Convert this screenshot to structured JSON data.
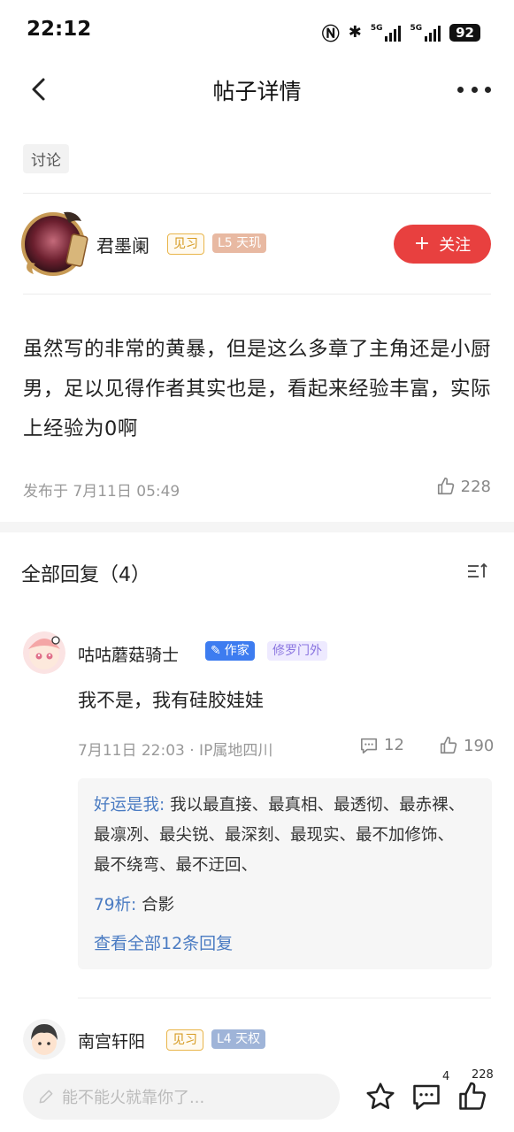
{
  "status_bar": {
    "time": "22:12",
    "battery": "92",
    "signal1": "5G",
    "signal2": "5G"
  },
  "nav": {
    "title": "帖子详情"
  },
  "post": {
    "tag": "讨论",
    "author": {
      "name": "君墨阑",
      "badge_role": "见习",
      "badge_level": "L5 天玑"
    },
    "follow_label": "关注",
    "body": "虽然写的非常的黄暴，但是这么多章了主角还是小厨男，足以见得作者其实也是，看起来经验丰富，实际上经验为0啊",
    "published": "发布于 7月11日 05:49",
    "likes": "228"
  },
  "replies": {
    "title": "全部回复（4）",
    "items": [
      {
        "name": "咕咕蘑菇骑士",
        "badge_role": "作家",
        "badge_realm": "修罗门外",
        "text": "我不是，我有硅胶娃娃",
        "meta": "7月11日 22:03 · IP属地四川",
        "comments": "12",
        "likes": "190",
        "sub_replies": [
          {
            "user": "好运是我:",
            "text": "我以最直接、最真相、最透彻、最赤裸、最凛冽、最尖锐、最深刻、最现实、最不加修饰、最不绕弯、最不迂回、"
          },
          {
            "user": "79析:",
            "text": "合影"
          }
        ],
        "view_all": "查看全部12条回复"
      },
      {
        "name": "南宫轩阳",
        "badge_role": "见习",
        "badge_level": "L4 天权"
      }
    ]
  },
  "bottom_bar": {
    "placeholder": "能不能火就靠你了...",
    "comment_count": "4",
    "like_count": "228"
  }
}
